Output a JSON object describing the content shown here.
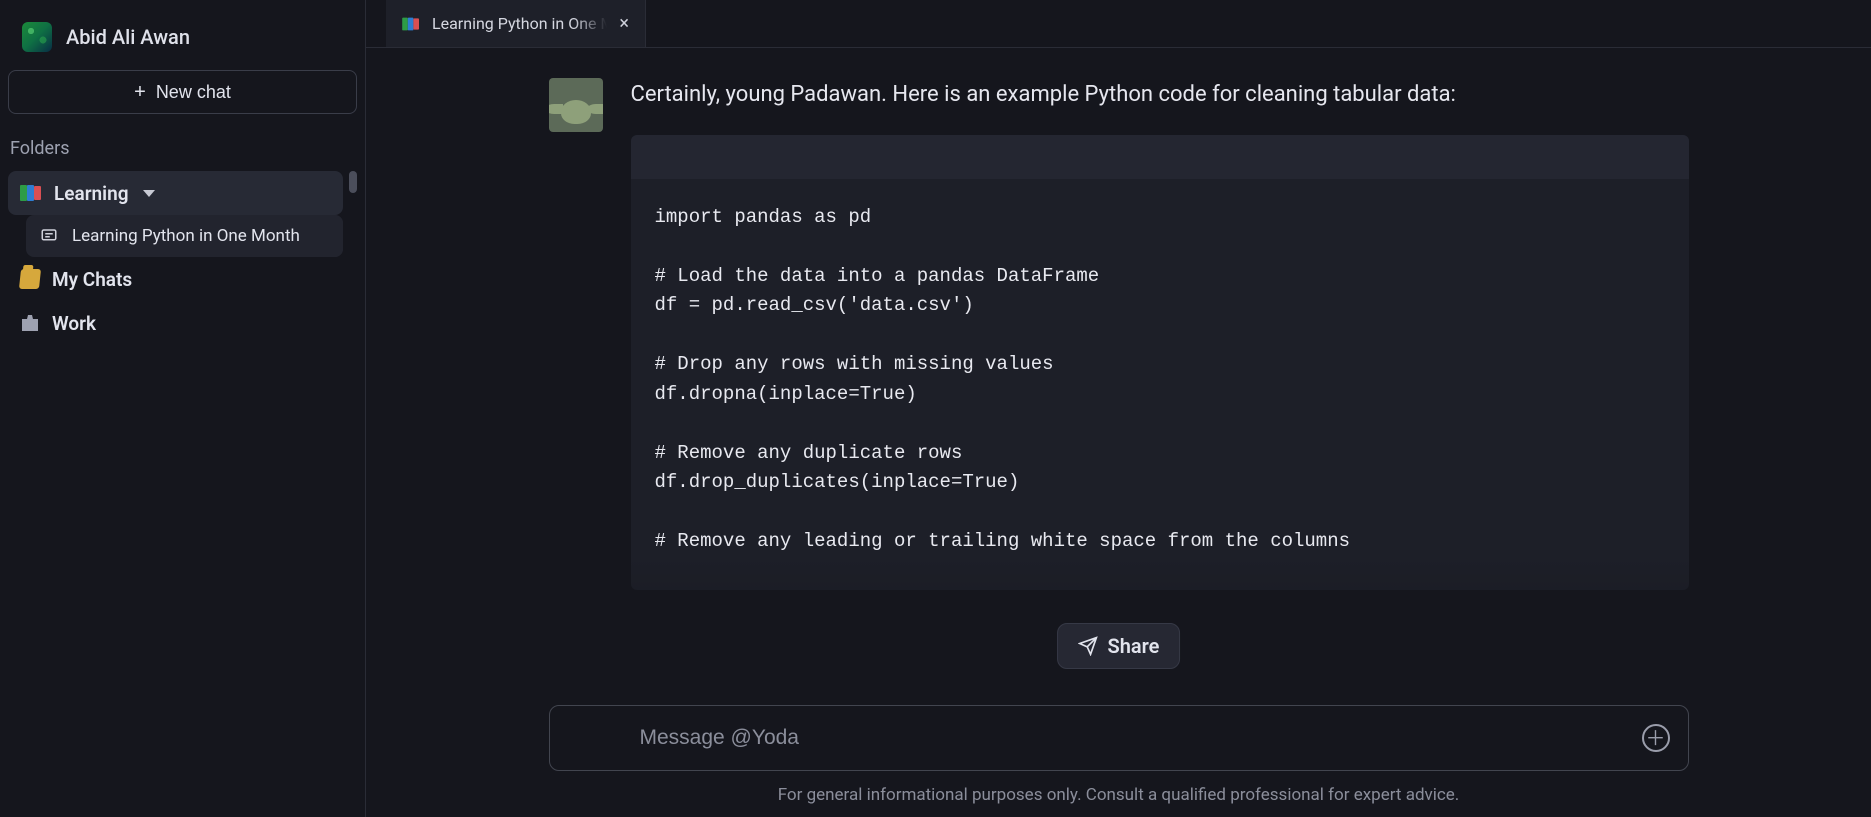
{
  "user": {
    "name": "Abid Ali Awan"
  },
  "sidebar": {
    "new_chat_label": "New chat",
    "folders_label": "Folders",
    "folders": [
      {
        "id": "learning",
        "label": "Learning",
        "expanded": true,
        "children": [
          {
            "id": "learning-python",
            "label": "Learning Python in One Month"
          }
        ]
      },
      {
        "id": "mychats",
        "label": "My Chats",
        "expanded": false,
        "children": []
      },
      {
        "id": "work",
        "label": "Work",
        "expanded": false,
        "children": []
      }
    ]
  },
  "tabs": [
    {
      "id": "learning-python",
      "label": "Learning Python in One Month"
    }
  ],
  "active_tab": "learning-python",
  "message": {
    "text": "Certainly, young Padawan. Here is an example Python code for cleaning tabular data:",
    "code": "import pandas as pd\n\n# Load the data into a pandas DataFrame\ndf = pd.read_csv('data.csv')\n\n# Drop any rows with missing values\ndf.dropna(inplace=True)\n\n# Remove any duplicate rows\ndf.drop_duplicates(inplace=True)\n\n# Remove any leading or trailing white space from the columns"
  },
  "share_label": "Share",
  "composer": {
    "placeholder": "Message @Yoda"
  },
  "disclaimer": "For general informational purposes only. Consult a qualified professional for expert advice."
}
